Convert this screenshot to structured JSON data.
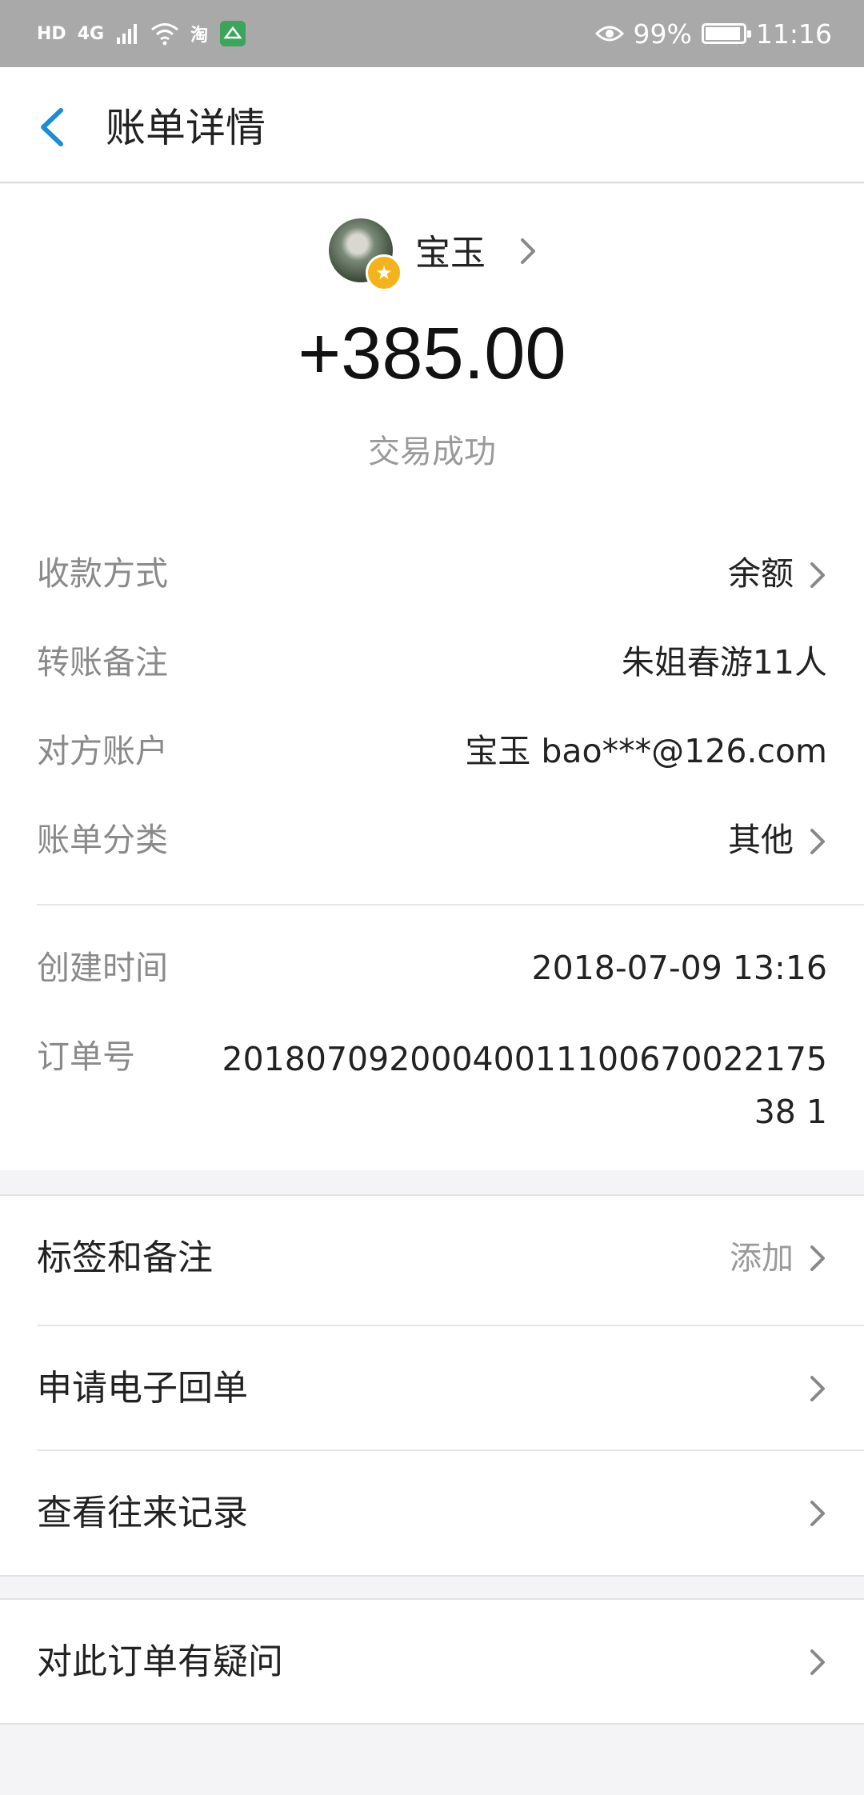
{
  "status_bar": {
    "hd": "HD",
    "network": "4G",
    "app_badge": "淘",
    "battery": "99%",
    "battery_level": 0.99,
    "time": "11:16"
  },
  "header": {
    "title": "账单详情"
  },
  "payee": {
    "name": "宝玉",
    "amount": "+385.00",
    "status": "交易成功"
  },
  "details": [
    {
      "label": "收款方式",
      "value": "余额"
    },
    {
      "label": "转账备注",
      "value": "朱姐春游11人"
    },
    {
      "label": "对方账户",
      "value": "宝玉 bao***@126.com"
    },
    {
      "label": "账单分类",
      "value": "其他"
    }
  ],
  "meta": {
    "created_label": "创建时间",
    "created_value": "2018-07-09 13:16",
    "order_label": "订单号",
    "order_value": "2018070920004001110067002217538 1"
  },
  "actions": {
    "tags_label": "标签和备注",
    "tags_action": "添加",
    "receipt_label": "申请电子回单",
    "history_label": "查看往来记录",
    "question_label": "对此订单有疑问"
  },
  "colors": {
    "accent": "#1a8cd8",
    "status_bar": "#a9a9a9",
    "badge": "#f4b21b"
  }
}
